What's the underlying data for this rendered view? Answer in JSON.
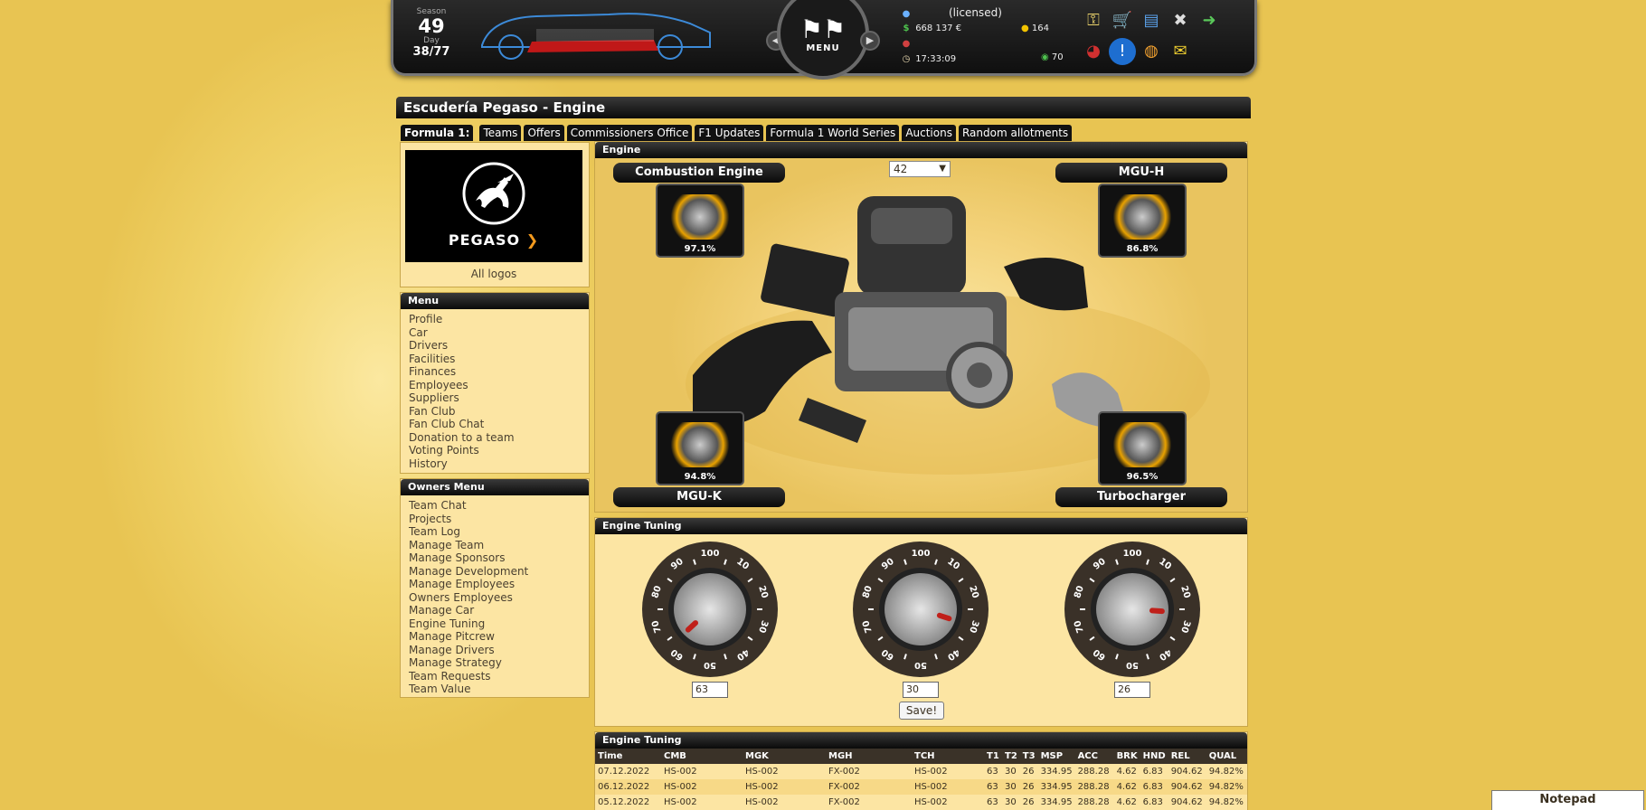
{
  "header": {
    "season_label": "Season",
    "season": "49",
    "day_label": "Day",
    "day": "38/77",
    "menu_label": "MENU",
    "license": "(licensed)",
    "money": "668 137 €",
    "time": "17:33:09",
    "coins": "164",
    "points": "70"
  },
  "page_title": "Escudería Pegaso - Engine",
  "tabs": {
    "lead": "Formula 1:",
    "items": [
      "Teams",
      "Offers",
      "Commissioners Office",
      "F1 Updates",
      "Formula 1 World Series",
      "Auctions",
      "Random allotments"
    ]
  },
  "team": {
    "logo_text": "PEGASO",
    "all_logos": "All logos"
  },
  "menu": {
    "title": "Menu",
    "items": [
      "Profile",
      "Car",
      "Drivers",
      "Facilities",
      "Finances",
      "Employees",
      "Suppliers",
      "Fan Club",
      "Fan Club Chat",
      "Donation to a team",
      "Voting Points",
      "History"
    ]
  },
  "owners_menu": {
    "title": "Owners Menu",
    "items": [
      "Team Chat",
      "Projects",
      "Team Log",
      "Manage Team",
      "Manage Sponsors",
      "Manage Development",
      "Manage Employees",
      "Owners Employees",
      "Manage Car",
      "Engine Tuning",
      "Manage Pitcrew",
      "Manage Drivers",
      "Manage Strategy",
      "Team Requests",
      "Team Value"
    ]
  },
  "engine": {
    "title": "Engine",
    "select_value": "42",
    "parts": {
      "combustion": {
        "name": "Combustion Engine",
        "pct": "97.1%"
      },
      "mguh": {
        "name": "MGU-H",
        "pct": "86.8%"
      },
      "mguk": {
        "name": "MGU-K",
        "pct": "94.8%"
      },
      "turbo": {
        "name": "Turbocharger",
        "pct": "96.5%"
      }
    }
  },
  "tuning": {
    "title": "Engine Tuning",
    "dial_labels": [
      "100",
      "10",
      "20",
      "30",
      "40",
      "50",
      "60",
      "70",
      "80",
      "90"
    ],
    "knobs": [
      {
        "value": "63"
      },
      {
        "value": "30"
      },
      {
        "value": "26"
      }
    ],
    "save_label": "Save!"
  },
  "history": {
    "title": "Engine Tuning",
    "columns": [
      "Time",
      "CMB",
      "MGK",
      "MGH",
      "TCH",
      "T1",
      "T2",
      "T3",
      "MSP",
      "ACC",
      "BRK",
      "HND",
      "REL",
      "QUAL"
    ],
    "rows": [
      [
        "07.12.2022",
        "HS-002",
        "HS-002",
        "FX-002",
        "HS-002",
        "63",
        "30",
        "26",
        "334.95",
        "288.28",
        "4.62",
        "6.83",
        "904.62",
        "94.82%"
      ],
      [
        "06.12.2022",
        "HS-002",
        "HS-002",
        "FX-002",
        "HS-002",
        "63",
        "30",
        "26",
        "334.95",
        "288.28",
        "4.62",
        "6.83",
        "904.62",
        "94.82%"
      ],
      [
        "05.12.2022",
        "HS-002",
        "HS-002",
        "FX-002",
        "HS-002",
        "63",
        "30",
        "26",
        "334.95",
        "288.28",
        "4.62",
        "6.83",
        "904.62",
        "94.82%"
      ]
    ]
  },
  "notepad": "Notepad",
  "colors": {
    "accent": "#e8c452",
    "panel": "#fce5a3",
    "dark": "#111111",
    "knob_marker": "#c0201a"
  }
}
